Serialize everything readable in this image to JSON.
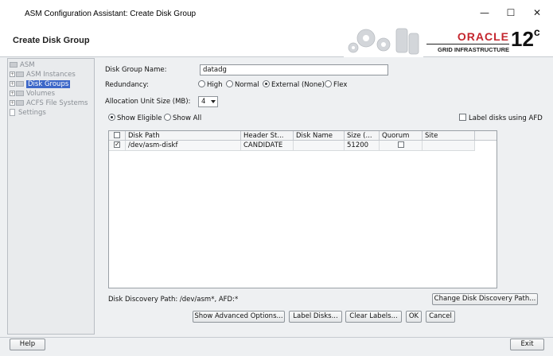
{
  "window": {
    "title": "ASM Configuration Assistant: Create Disk Group",
    "minimize": "—",
    "maximize": "☐",
    "close": "✕"
  },
  "header": {
    "page_title": "Create Disk Group",
    "brand": "ORACLE",
    "brand_sub": "GRID INFRASTRUCTURE",
    "version": "12",
    "version_suffix": "c"
  },
  "nav": {
    "items": [
      {
        "label": "ASM",
        "active": false
      },
      {
        "label": "ASM Instances",
        "active": false
      },
      {
        "label": "Disk Groups",
        "active": true
      },
      {
        "label": "Volumes",
        "active": false
      },
      {
        "label": "ACFS File Systems",
        "active": false
      },
      {
        "label": "Settings",
        "active": false
      }
    ]
  },
  "form": {
    "disk_group_name_label": "Disk Group Name:",
    "disk_group_name_value": "datadg",
    "redundancy_label": "Redundancy:",
    "redundancy_options": [
      "High",
      "Normal",
      "External (None)",
      "Flex"
    ],
    "redundancy_selected": "External (None)",
    "au_size_label": "Allocation Unit Size (MB):",
    "au_size_value": "4",
    "show_eligible": "Show Eligible",
    "show_all": "Show All",
    "label_afd": "Label disks using AFD"
  },
  "table": {
    "columns": [
      "",
      "Disk Path",
      "Header St...",
      "Disk Name",
      "Size (...",
      "Quorum",
      "Site"
    ],
    "rows": [
      {
        "selected": true,
        "disk_path": "/dev/asm-diskf",
        "header_status": "CANDIDATE",
        "disk_name": "",
        "size": "51200",
        "quorum": false,
        "site": ""
      }
    ]
  },
  "discovery": {
    "path_text": "Disk Discovery Path: /dev/asm*, AFD:*",
    "change_button": "Change Disk Discovery Path..."
  },
  "actions": {
    "advanced": "Show Advanced Options...",
    "label_disks": "Label Disks...",
    "clear_labels": "Clear Labels...",
    "ok": "OK",
    "cancel": "Cancel"
  },
  "footer": {
    "help": "Help",
    "exit": "Exit"
  },
  "colors": {
    "oracle_red": "#c4262e",
    "selection_blue": "#3c67c8",
    "background": "#eef0f2"
  }
}
